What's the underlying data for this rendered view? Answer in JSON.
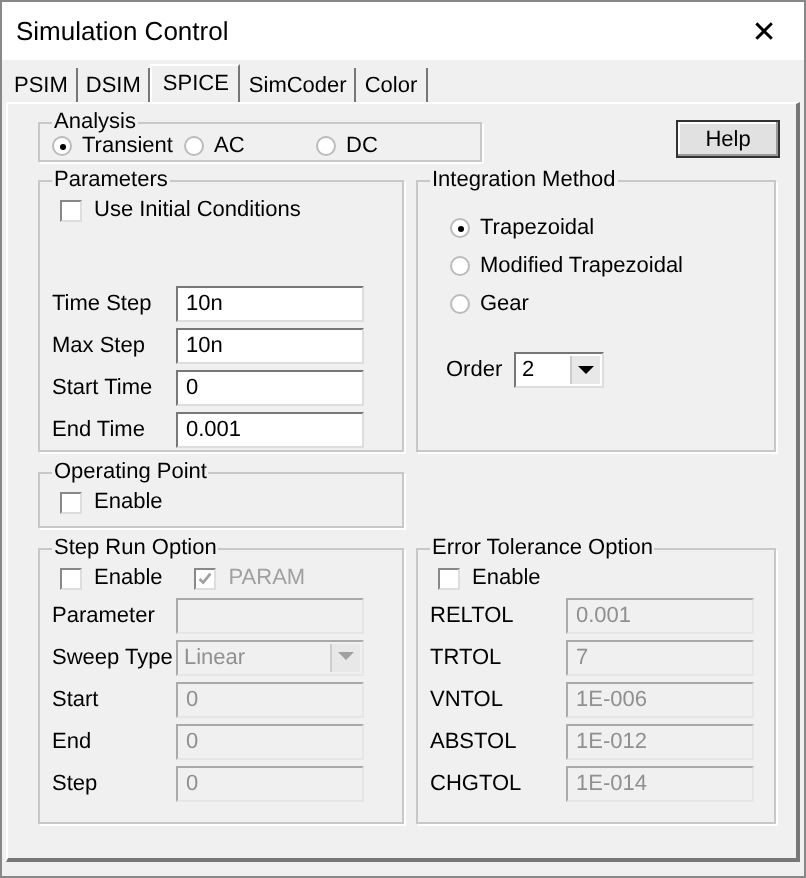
{
  "window": {
    "title": "Simulation Control",
    "close": "✕"
  },
  "tabs": [
    {
      "label": "PSIM",
      "selected": false
    },
    {
      "label": "DSIM",
      "selected": false
    },
    {
      "label": "SPICE",
      "selected": true
    },
    {
      "label": "SimCoder",
      "selected": false
    },
    {
      "label": "Color",
      "selected": false
    }
  ],
  "analysis": {
    "title": "Analysis",
    "options": [
      {
        "label": "Transient",
        "selected": true
      },
      {
        "label": "AC",
        "selected": false
      },
      {
        "label": "DC",
        "selected": false
      }
    ]
  },
  "help_button": "Help",
  "parameters": {
    "title": "Parameters",
    "use_initial_conditions": {
      "label": "Use Initial Conditions",
      "checked": false
    },
    "fields": [
      {
        "label": "Time Step",
        "value": "10n"
      },
      {
        "label": "Max Step",
        "value": "10n"
      },
      {
        "label": "Start Time",
        "value": "0"
      },
      {
        "label": "End Time",
        "value": "0.001"
      }
    ]
  },
  "integration_method": {
    "title": "Integration Method",
    "options": [
      {
        "label": "Trapezoidal",
        "selected": true
      },
      {
        "label": "Modified Trapezoidal",
        "selected": false
      },
      {
        "label": "Gear",
        "selected": false
      }
    ],
    "order": {
      "label": "Order",
      "value": "2"
    }
  },
  "operating_point": {
    "title": "Operating Point",
    "enable": {
      "label": "Enable",
      "checked": false
    }
  },
  "step_run": {
    "title": "Step Run Option",
    "enable": {
      "label": "Enable",
      "checked": false
    },
    "param": {
      "label": "PARAM",
      "checked": true,
      "disabled": true
    },
    "fields": [
      {
        "label": "Parameter",
        "kind": "text",
        "disabled": true
      },
      {
        "label": "Sweep Type",
        "value": "Linear",
        "kind": "dropdown",
        "disabled": true
      },
      {
        "label": "Start",
        "value": "0",
        "kind": "text",
        "disabled": true
      },
      {
        "label": "End",
        "value": "0",
        "kind": "text",
        "disabled": true
      },
      {
        "label": "Step",
        "value": "0",
        "kind": "text",
        "disabled": true
      }
    ]
  },
  "error_tolerance": {
    "title": "Error Tolerance Option",
    "enable": {
      "label": "Enable",
      "checked": false
    },
    "fields": [
      {
        "label": "RELTOL",
        "value": "0.001",
        "disabled": true
      },
      {
        "label": "TRTOL",
        "value": "7",
        "disabled": true
      },
      {
        "label": "VNTOL",
        "value": "1E-006",
        "disabled": true
      },
      {
        "label": "ABSTOL",
        "value": "1E-012",
        "disabled": true
      },
      {
        "label": "CHGTOL",
        "value": "1E-014",
        "disabled": true
      }
    ]
  }
}
